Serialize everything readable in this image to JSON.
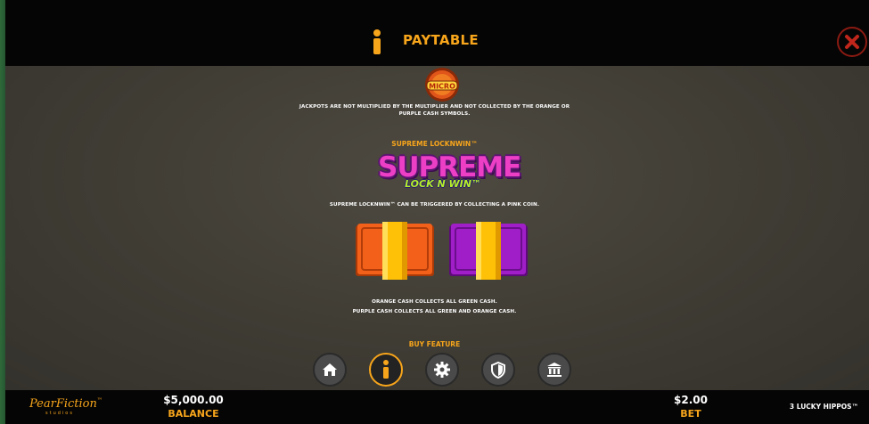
{
  "header": {
    "title": "PAYTABLE",
    "close_icon": "close-icon",
    "info_icon": "info-icon"
  },
  "content": {
    "micro_badge": "MICRO",
    "jackpot_note_line1": "JACKPOTS ARE NOT MULTIPLIED BY THE MULTIPLIER AND NOT COLLECTED BY THE ORANGE OR",
    "jackpot_note_line2": "PURPLE CASH SYMBOLS.",
    "section_title": "SUPREME LOCKNWIN™",
    "logo_line1": "SUPREME",
    "logo_line2": "LOCK N WIN™",
    "trigger_note": "SUPREME LOCKNWIN™ CAN BE TRIGGERED BY COLLECTING A PINK COIN.",
    "orange_note": "ORANGE CASH COLLECTS ALL GREEN CASH.",
    "purple_note": "PURPLE CASH COLLECTS ALL GREEN AND ORANGE CASH.",
    "next_section_partial": "BUY FEATURE"
  },
  "dock": {
    "items": [
      "home-icon",
      "info-icon",
      "settings-icon",
      "shield-icon",
      "bank-icon"
    ],
    "active": "info-icon"
  },
  "footer": {
    "brand_name": "PearFiction",
    "brand_tm": "™",
    "brand_sub": "studios",
    "balance_value": "$5,000.00",
    "balance_label": "BALANCE",
    "bet_value": "$2.00",
    "bet_label": "BET",
    "game_name": "3 LUCKY HIPPOS™"
  },
  "colors": {
    "accent": "#f7a51b",
    "close": "#c0261b",
    "orange_cash": "#f2601a",
    "purple_cash": "#a01ec8",
    "band": "#ffc107"
  }
}
